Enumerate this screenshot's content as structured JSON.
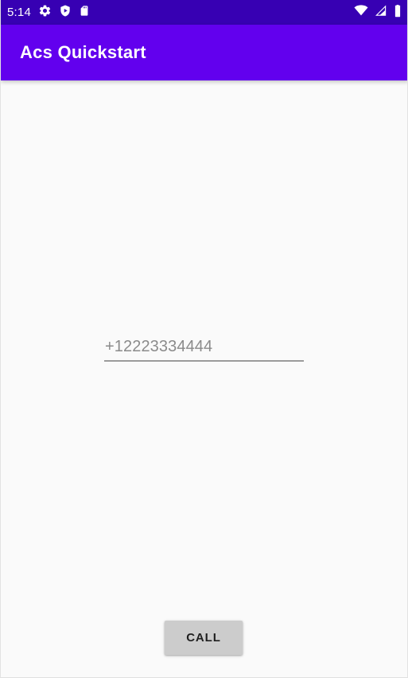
{
  "status_bar": {
    "clock": "5:14",
    "left_icons": [
      {
        "name": "settings-gear-icon"
      },
      {
        "name": "play-protect-shield-icon"
      },
      {
        "name": "sd-card-icon"
      }
    ],
    "right_icons": [
      {
        "name": "wifi-icon"
      },
      {
        "name": "cellular-signal-icon"
      },
      {
        "name": "battery-icon"
      }
    ],
    "background_color": "#3700B3",
    "foreground_color": "#FFFFFF"
  },
  "app_bar": {
    "title": "Acs Quickstart",
    "background_color": "#6200EE",
    "title_color": "#FFFFFF"
  },
  "content": {
    "background_color": "#FAFAFA",
    "phone_input": {
      "value": "+12223334444",
      "placeholder": "+12223334444",
      "text_color": "#8B8B8B",
      "underline_color": "#9B9B9B"
    },
    "call_button": {
      "label": "CALL",
      "background_color": "#CCCCCC",
      "text_color": "#1F1F1F"
    }
  }
}
